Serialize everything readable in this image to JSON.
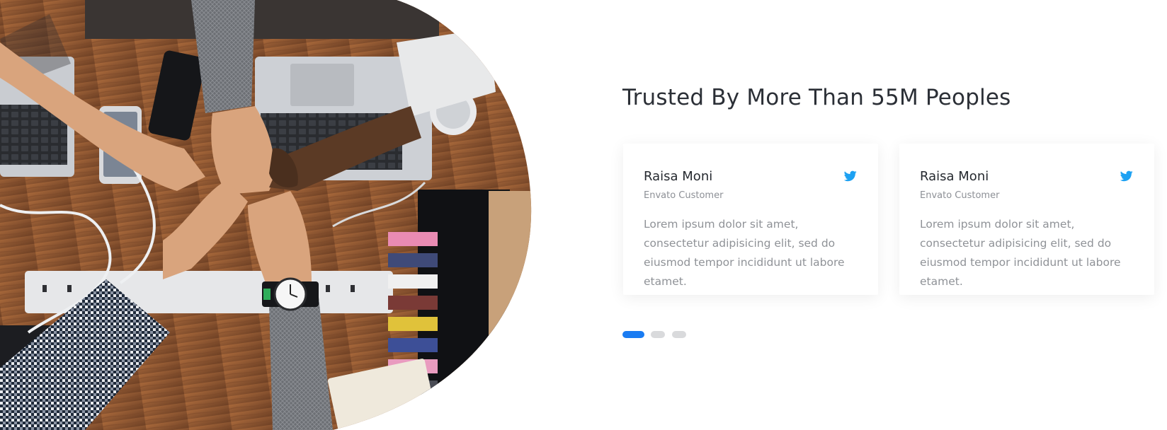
{
  "hero": {
    "image_alt": "team of hands fist-bumping over a wooden desk with laptops"
  },
  "testimonials": {
    "heading": "Trusted By More Than 55M Peoples",
    "cards": [
      {
        "name": "Raisa Moni",
        "role": "Envato Customer",
        "quote": "Lorem ipsum dolor sit amet, consectetur adipisicing elit, sed do eiusmod tempor incididunt ut labore etamet.",
        "icon": "twitter-icon"
      },
      {
        "name": "Raisa Moni",
        "role": "Envato Customer",
        "quote": "Lorem ipsum dolor sit amet, consectetur adipisicing elit, sed do eiusmod tempor incididunt ut labore etamet.",
        "icon": "twitter-icon"
      }
    ],
    "pagination": {
      "count": 3,
      "active_index": 0
    }
  },
  "colors": {
    "accent": "#1a7cf2",
    "twitter": "#1da1f2",
    "heading": "#2b2f36",
    "muted_text": "#8f9297",
    "inactive_dot": "#d9dadc"
  }
}
